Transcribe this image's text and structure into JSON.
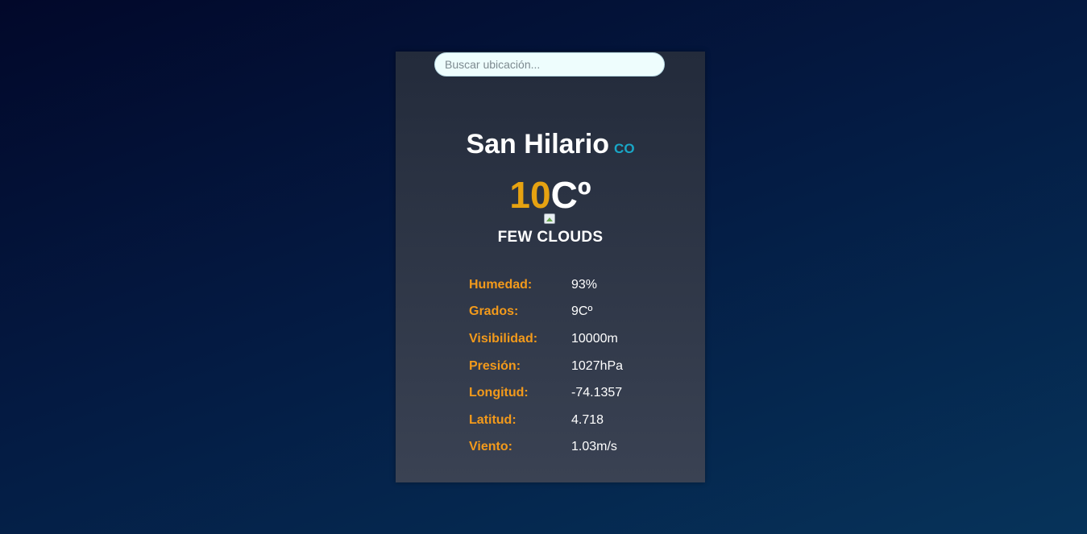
{
  "search": {
    "placeholder": "Buscar ubicación...",
    "value": ""
  },
  "location": {
    "city": "San Hilario",
    "country_code": "CO"
  },
  "temperature": {
    "value": "10",
    "unit": "Cº"
  },
  "weather": {
    "icon": "broken-image-icon",
    "description": "FEW CLOUDS"
  },
  "details": [
    {
      "label": "Humedad:",
      "value": "93%"
    },
    {
      "label": "Grados:",
      "value": "9Cº"
    },
    {
      "label": "Visibilidad:",
      "value": "10000m"
    },
    {
      "label": "Presión:",
      "value": "1027hPa"
    },
    {
      "label": "Longitud:",
      "value": "-74.1357"
    },
    {
      "label": "Latitud:",
      "value": "4.718"
    },
    {
      "label": "Viento:",
      "value": "1.03m/s"
    }
  ],
  "colors": {
    "temperature_accent": "#e6a211",
    "label_accent": "#f39a1b",
    "country_accent": "#19a7c7"
  }
}
